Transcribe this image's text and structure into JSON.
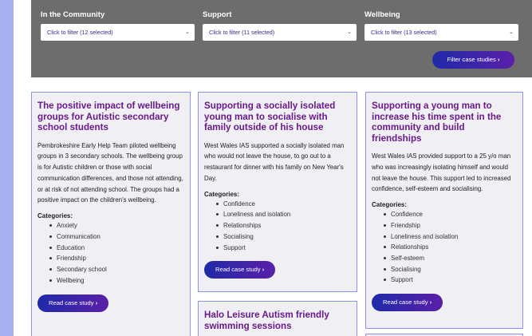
{
  "filters": [
    {
      "label": "In the Community",
      "value": "Click to filter (12 selected)"
    },
    {
      "label": "Support",
      "value": "Click to filter (11 selected)"
    },
    {
      "label": "Wellbeing",
      "value": "Click to filter (13 selected)"
    }
  ],
  "filter_button": "Filter case studies",
  "categories_label": "Categories:",
  "read_button": "Read case study",
  "cards": [
    {
      "title": "The positive impact of wellbeing groups for Autistic secondary school students",
      "description": "Pembrokeshire Early Help Team piloted wellbeing groups in 3 secondary schools. The wellbeing group is for Autistic children or those with social communication differences, and those not attending, or at risk of not attending school. The groups had a positive impact on the children's wellbeing.",
      "categories": [
        "Anxiety",
        "Communication",
        "Education",
        "Friendship",
        "Secondary school",
        "Wellbeing"
      ]
    },
    {
      "title": "Supporting a socially isolated young man to socialise with family outside of his house",
      "description": "West Wales IAS supported a socially isolated man who would not leave the house, to go out to a restaurant for dinner with his family on New Year's Day.",
      "categories": [
        "Confidence",
        "Loneliness and isolation",
        "Relationships",
        "Socialising",
        "Support"
      ]
    },
    {
      "title": "Supporting a young man to increase his time spent in the community and build friendships",
      "description": "West Wales IAS provided support to a 25 y/o man who was increasingly isolating himself and would not leave the house. This support led to increased confidence, self-esteem and socialising.",
      "categories": [
        "Confidence",
        "Friendship",
        "Loneliness and isolation",
        "Relationships",
        "Self-esteem",
        "Socialising",
        "Support"
      ]
    },
    {
      "title": "Halo Leisure Autism friendly swimming sessions"
    }
  ]
}
